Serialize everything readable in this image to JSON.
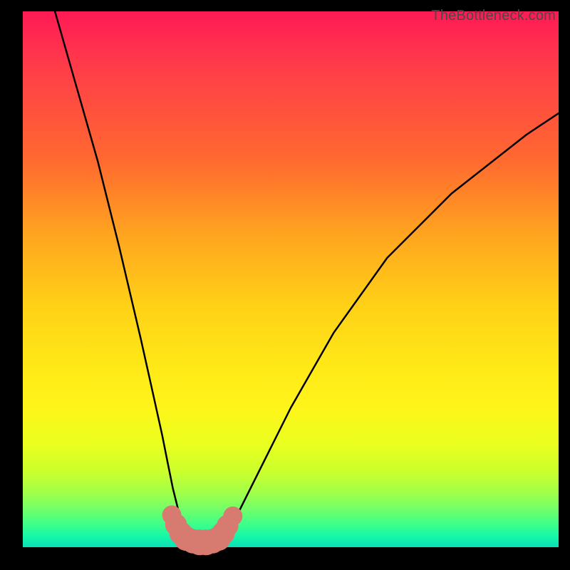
{
  "attribution": "TheBottleneck.com",
  "chart_data": {
    "type": "line",
    "title": "",
    "xlabel": "",
    "ylabel": "",
    "xlim": [
      0,
      100
    ],
    "ylim": [
      0,
      100
    ],
    "background_gradient_stops": [
      {
        "pct": 0,
        "color": "#ff1a55"
      },
      {
        "pct": 28,
        "color": "#ff6a2f"
      },
      {
        "pct": 55,
        "color": "#ffd117"
      },
      {
        "pct": 74,
        "color": "#fff51a"
      },
      {
        "pct": 90,
        "color": "#9fff4a"
      },
      {
        "pct": 100,
        "color": "#0be0b6"
      }
    ],
    "series": [
      {
        "name": "curve",
        "stroke": "#000000",
        "x": [
          6,
          10,
          14,
          18,
          22,
          24,
          26,
          27,
          28,
          29,
          30,
          31,
          32,
          33,
          34,
          35,
          36,
          37,
          38,
          40,
          44,
          50,
          58,
          68,
          80,
          94,
          100
        ],
        "y": [
          100,
          86,
          72,
          56,
          39,
          30,
          21,
          16,
          11,
          7,
          4,
          2.4,
          1.6,
          1.2,
          1.0,
          1.0,
          1.2,
          1.8,
          3,
          6,
          14,
          26,
          40,
          54,
          66,
          77,
          81
        ]
      }
    ],
    "markers": {
      "name": "baseline-highlight",
      "color": "#d77a6f",
      "points": [
        {
          "x": 27.8,
          "y": 6.0,
          "r": 1.5
        },
        {
          "x": 28.6,
          "y": 4.2,
          "r": 1.7
        },
        {
          "x": 29.5,
          "y": 2.6,
          "r": 1.8
        },
        {
          "x": 30.5,
          "y": 1.6,
          "r": 1.9
        },
        {
          "x": 31.8,
          "y": 1.1,
          "r": 1.9
        },
        {
          "x": 33.0,
          "y": 0.9,
          "r": 2.0
        },
        {
          "x": 34.2,
          "y": 0.9,
          "r": 2.0
        },
        {
          "x": 35.4,
          "y": 1.1,
          "r": 1.9
        },
        {
          "x": 36.5,
          "y": 1.6,
          "r": 1.9
        },
        {
          "x": 37.4,
          "y": 2.6,
          "r": 1.8
        },
        {
          "x": 38.2,
          "y": 4.0,
          "r": 1.7
        },
        {
          "x": 39.2,
          "y": 5.8,
          "r": 1.5
        }
      ]
    }
  }
}
